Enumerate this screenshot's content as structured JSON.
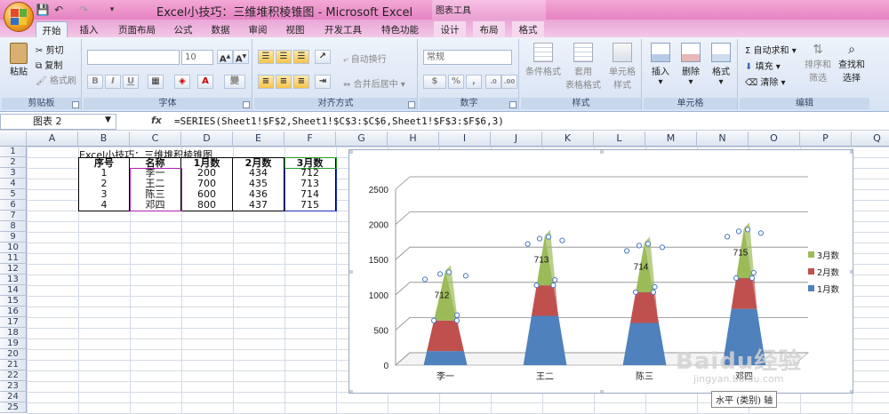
{
  "app": {
    "title": "Excel小技巧：三维堆积棱锥图 - Microsoft Excel",
    "context_tab_group": "图表工具"
  },
  "tabs": [
    {
      "label": "开始",
      "active": true
    },
    {
      "label": "插入"
    },
    {
      "label": "页面布局"
    },
    {
      "label": "公式"
    },
    {
      "label": "数据"
    },
    {
      "label": "审阅"
    },
    {
      "label": "视图"
    },
    {
      "label": "开发工具"
    },
    {
      "label": "特色功能"
    },
    {
      "label": "设计",
      "tool": true
    },
    {
      "label": "布局",
      "tool": true
    },
    {
      "label": "格式",
      "tool": true
    }
  ],
  "ribbon": {
    "clipboard": {
      "label": "剪贴板",
      "paste": "粘贴",
      "cut": "剪切",
      "copy": "复制",
      "format_painter": "格式刷"
    },
    "font": {
      "label": "字体",
      "font_name": "",
      "font_size": "10",
      "bold": "B",
      "italic": "I",
      "underline": "U",
      "phonetic": "變"
    },
    "alignment": {
      "label": "对齐方式",
      "wrap": "自动换行",
      "merge": "合并后居中"
    },
    "number": {
      "label": "数字",
      "format": "常规",
      "percent": "%"
    },
    "styles": {
      "label": "样式",
      "conditional": "条件格式",
      "table": "套用\n表格格式",
      "cell": "单元格\n样式"
    },
    "cells": {
      "label": "单元格",
      "insert": "插入",
      "delete": "删除",
      "format": "格式"
    },
    "editing": {
      "label": "编辑",
      "autosum": "自动求和",
      "fill": "填充",
      "clear": "清除",
      "sort": "排序和\n筛选",
      "find": "查找和\n选择"
    }
  },
  "formula_bar": {
    "name_box": "图表 2",
    "fx": "fx",
    "formula": "=SERIES(Sheet1!$F$2,Sheet1!$C$3:$C$6,Sheet1!$F$3:$F$6,3)"
  },
  "columns": [
    "A",
    "B",
    "C",
    "D",
    "E",
    "F",
    "G",
    "H",
    "I",
    "J",
    "K",
    "L",
    "M",
    "N",
    "O",
    "P",
    "Q"
  ],
  "rows": [
    "1",
    "2",
    "3",
    "4",
    "5",
    "6",
    "7",
    "8",
    "9",
    "10",
    "11",
    "12",
    "13",
    "14",
    "15",
    "16",
    "17",
    "18",
    "19",
    "20",
    "21",
    "22",
    "23",
    "24",
    "25"
  ],
  "sheet": {
    "title": "Excel小技巧：三维堆积棱锥图",
    "headers": [
      "序号",
      "名称",
      "1月数",
      "2月数",
      "3月数"
    ],
    "rows": [
      [
        "1",
        "李一",
        "200",
        "434",
        "712"
      ],
      [
        "2",
        "王二",
        "700",
        "435",
        "713"
      ],
      [
        "3",
        "陈三",
        "600",
        "436",
        "714"
      ],
      [
        "4",
        "邓四",
        "800",
        "437",
        "715"
      ]
    ]
  },
  "chart_data": {
    "type": "bar",
    "subtype": "3d-stacked-pyramid",
    "categories": [
      "李一",
      "王二",
      "陈三",
      "邓四"
    ],
    "series": [
      {
        "name": "1月数",
        "values": [
          200,
          700,
          600,
          800
        ],
        "color": "#4f81bd"
      },
      {
        "name": "2月数",
        "values": [
          434,
          435,
          436,
          437
        ],
        "color": "#c0504d"
      },
      {
        "name": "3月数",
        "values": [
          712,
          713,
          714,
          715
        ],
        "color": "#9bbb59"
      }
    ],
    "data_labels": {
      "series": "3月数",
      "values": [
        "712",
        "713",
        "714",
        "715"
      ]
    },
    "y_ticks": [
      "0",
      "500",
      "1000",
      "1500",
      "2000",
      "2500"
    ],
    "ylim": [
      0,
      2500
    ],
    "legend": "right",
    "grid": true
  },
  "tooltip": "水平 (类别) 轴",
  "watermark": {
    "brand": "Baidu经验",
    "url": "jingyan.baidu.com"
  }
}
